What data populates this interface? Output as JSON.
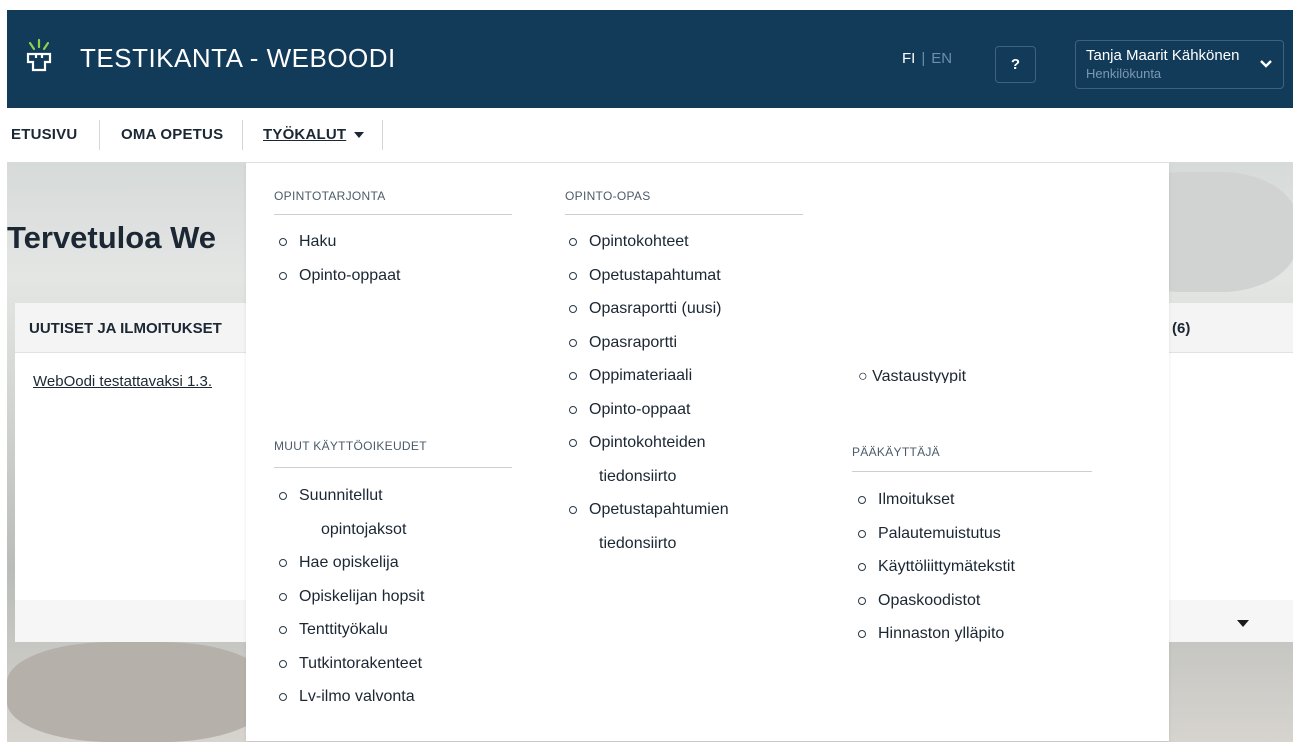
{
  "header": {
    "app_title": "TESTIKANTA - WEBOODI",
    "lang_active": "FI",
    "lang_separator": "|",
    "lang_other": "EN",
    "help_label": "?",
    "user_name": "Tanja Maarit Kähkönen",
    "user_role": "Henkilökunta",
    "colors": {
      "background": "#123a59"
    }
  },
  "nav": {
    "items": [
      {
        "label": "ETUSIVU"
      },
      {
        "label": "OMA OPETUS"
      },
      {
        "label": "TYÖKALUT"
      }
    ]
  },
  "page": {
    "welcome": "Tervetuloa We",
    "news_title": "UUTISET JA ILMOITUKSET",
    "news_count": "(6)",
    "news_link": "WebOodi testattavaksi 1.3."
  },
  "menu": {
    "opintotarjonta": {
      "heading": "OPINTOTARJONTA",
      "items": [
        "Haku",
        "Opinto-oppaat"
      ]
    },
    "muut": {
      "heading": "MUUT KÄYTTÖOIKEUDET",
      "items": [
        "Suunnitellut",
        "opintojaksot",
        "Hae opiskelija",
        "Opiskelijan hopsit",
        "Tenttityökalu",
        "Tutkintorakenteet",
        "Lv-ilmo valvonta"
      ]
    },
    "opintoopas": {
      "heading": "OPINTO-OPAS",
      "items": [
        "Opintokohteet",
        "Opetustapahtumat",
        "Opasraportti (uusi)",
        "Opasraportti",
        "Oppimateriaali",
        "Opinto-oppaat",
        "Opintokohteiden",
        "tiedonsiirto",
        "Opetustapahtumien",
        "tiedonsiirto"
      ]
    },
    "partial_item": "Vastaustyypit",
    "paakayttaja": {
      "heading": "PÄÄKÄYTTÄJÄ",
      "items": [
        "Ilmoitukset",
        "Palautemuistutus",
        "Käyttöliittymätekstit",
        "Opaskoodistot",
        "Hinnaston ylläpito"
      ]
    }
  }
}
